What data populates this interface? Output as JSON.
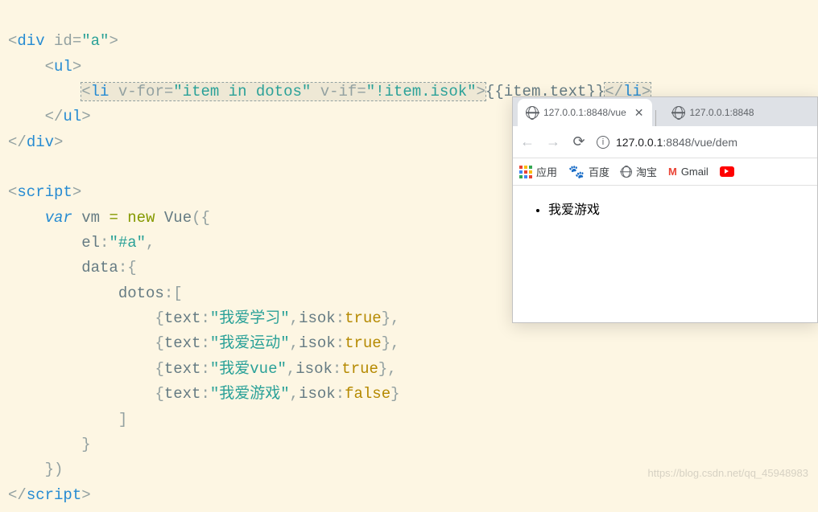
{
  "code": {
    "tag_div": "div",
    "tag_ul": "ul",
    "tag_li": "li",
    "tag_script": "script",
    "attr_id": "id",
    "attr_vfor": "v-for",
    "attr_vif": "v-if",
    "val_a": "\"a\"",
    "val_vfor": "\"item in dotos\"",
    "val_vif": "\"!item.isok\"",
    "mustache": "{{item.text}}",
    "kw_var": "var",
    "ident_vm": "vm",
    "kw_new": "new",
    "ident_Vue": "Vue",
    "prop_el": "el",
    "val_el": "\"#a\"",
    "prop_data": "data",
    "prop_dotos": "dotos",
    "prop_text": "text",
    "prop_isok": "isok",
    "items": [
      {
        "text": "\"我爱学习\"",
        "isok": "true"
      },
      {
        "text": "\"我爱运动\"",
        "isok": "true"
      },
      {
        "text": "\"我爱vue\"",
        "isok": "true"
      },
      {
        "text": "\"我爱游戏\"",
        "isok": "false"
      }
    ]
  },
  "browser": {
    "tab1_title": "127.0.0.1:8848/vue",
    "tab2_title": "127.0.0.1:8848",
    "url_host": "127.0.0.1",
    "url_port": ":8848",
    "url_path": "/vue/dem",
    "bookmarks": {
      "apps": "应用",
      "baidu": "百度",
      "taobao": "淘宝",
      "gmail": "Gmail"
    },
    "page_list_item": "我爱游戏"
  },
  "watermark": "https://blog.csdn.net/qq_45948983"
}
